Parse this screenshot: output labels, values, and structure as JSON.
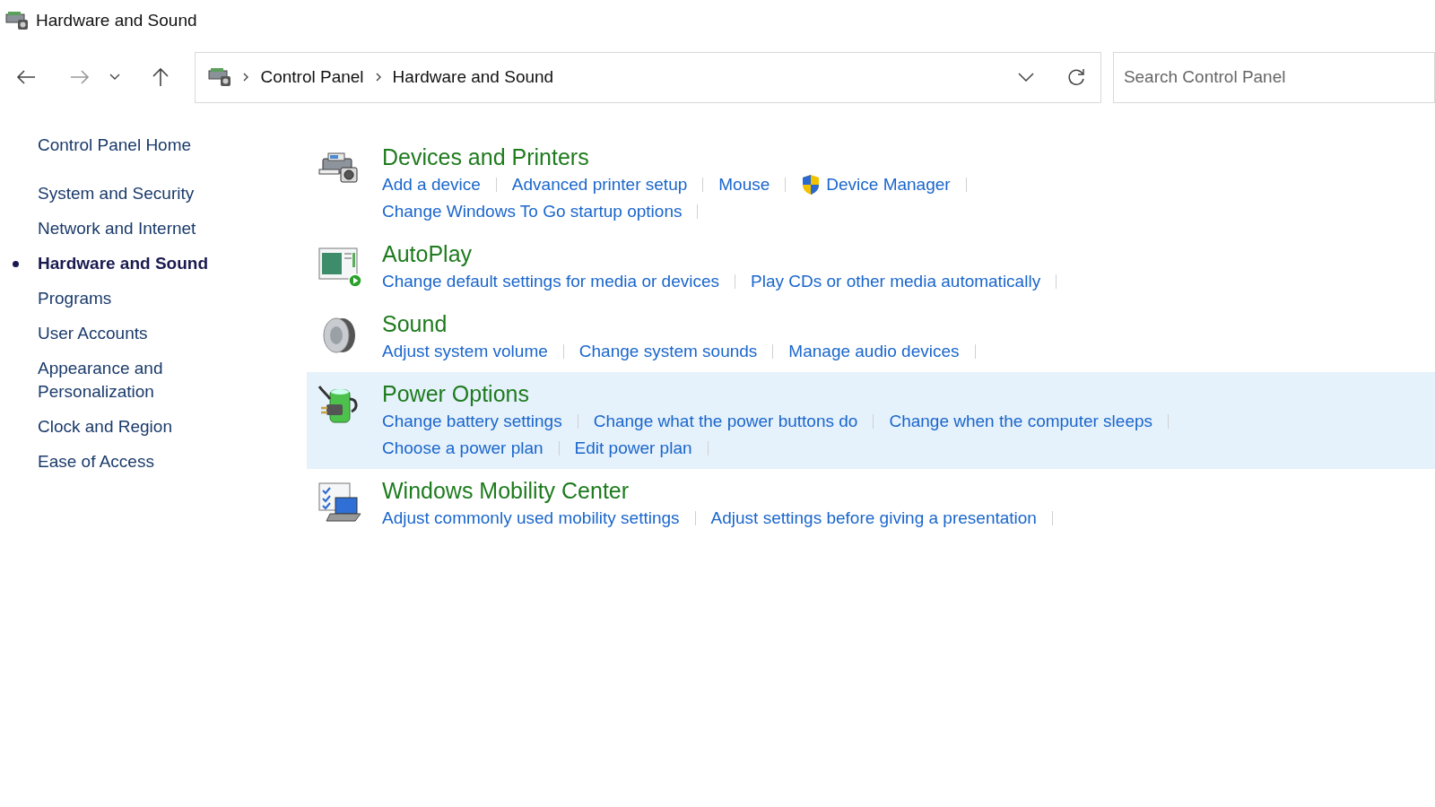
{
  "window": {
    "title": "Hardware and Sound"
  },
  "address_bar": {
    "breadcrumbs": [
      "Control Panel",
      "Hardware and Sound"
    ]
  },
  "search": {
    "placeholder": "Search Control Panel"
  },
  "sidebar": {
    "items": [
      {
        "label": "Control Panel Home",
        "selected": false
      },
      {
        "label": "System and Security",
        "selected": false
      },
      {
        "label": "Network and Internet",
        "selected": false
      },
      {
        "label": "Hardware and Sound",
        "selected": true
      },
      {
        "label": "Programs",
        "selected": false
      },
      {
        "label": "User Accounts",
        "selected": false
      },
      {
        "label": "Appearance and Personalization",
        "selected": false
      },
      {
        "label": "Clock and Region",
        "selected": false
      },
      {
        "label": "Ease of Access",
        "selected": false
      }
    ]
  },
  "sections": [
    {
      "kind": "printer",
      "title": "Devices and Printers",
      "highlighted": false,
      "link_lines": [
        [
          {
            "text": "Add a device",
            "shield": false
          },
          {
            "text": "Advanced printer setup",
            "shield": false
          },
          {
            "text": "Mouse",
            "shield": false
          },
          {
            "text": "Device Manager",
            "shield": true
          }
        ],
        [
          {
            "text": "Change Windows To Go startup options",
            "shield": false
          }
        ]
      ]
    },
    {
      "kind": "autoplay",
      "title": "AutoPlay",
      "highlighted": false,
      "link_lines": [
        [
          {
            "text": "Change default settings for media or devices",
            "shield": false
          },
          {
            "text": "Play CDs or other media automatically",
            "shield": false
          }
        ]
      ]
    },
    {
      "kind": "speaker",
      "title": "Sound",
      "highlighted": false,
      "link_lines": [
        [
          {
            "text": "Adjust system volume",
            "shield": false
          },
          {
            "text": "Change system sounds",
            "shield": false
          },
          {
            "text": "Manage audio devices",
            "shield": false
          }
        ]
      ]
    },
    {
      "kind": "battery",
      "title": "Power Options",
      "highlighted": true,
      "link_lines": [
        [
          {
            "text": "Change battery settings",
            "shield": false
          },
          {
            "text": "Change what the power buttons do",
            "shield": false
          },
          {
            "text": "Change when the computer sleeps",
            "shield": false
          }
        ],
        [
          {
            "text": "Choose a power plan",
            "shield": false
          },
          {
            "text": "Edit power plan",
            "shield": false
          }
        ]
      ]
    },
    {
      "kind": "laptop",
      "title": "Windows Mobility Center",
      "highlighted": false,
      "link_lines": [
        [
          {
            "text": "Adjust commonly used mobility settings",
            "shield": false
          },
          {
            "text": "Adjust settings before giving a presentation",
            "shield": false
          }
        ]
      ]
    }
  ]
}
